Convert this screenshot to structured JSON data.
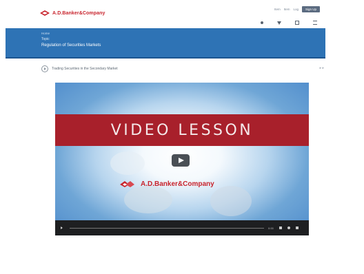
{
  "header": {
    "brand": "A.D.Banker&Company",
    "nav": [
      "Item",
      "Item",
      "Log"
    ],
    "signup_label": "Sign Up",
    "icons": [
      "pin-icon",
      "bell-icon",
      "user-icon",
      "menu-icon"
    ]
  },
  "hero": {
    "crumb": "Home",
    "sub": "Topic",
    "title": "Regulation of Securities Markets"
  },
  "lesson": {
    "title": "Trading Securities in the Secondary Market",
    "control": "▸ ▸"
  },
  "video": {
    "banner": "VIDEO LESSON",
    "logo_text": "A.D.Banker&Company",
    "time": "0:00"
  },
  "colors": {
    "brand_red": "#c8232c",
    "banner_red": "#a8202b",
    "hero_blue": "#2e73b5"
  }
}
